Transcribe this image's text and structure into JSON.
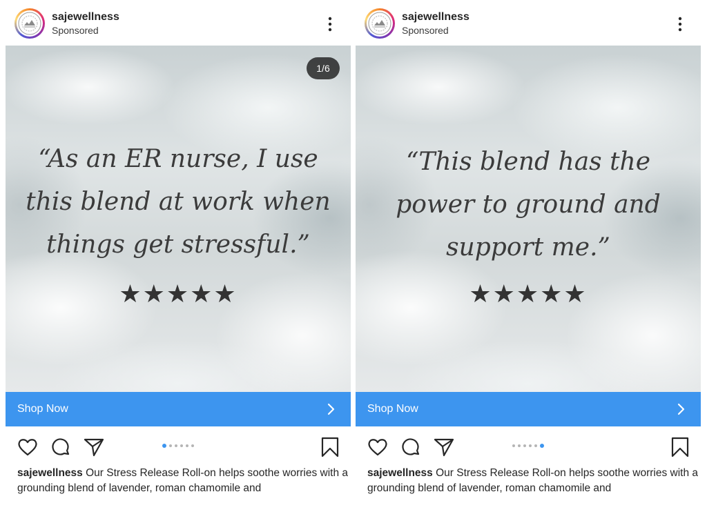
{
  "posts": [
    {
      "username": "sajewellness",
      "sponsored_label": "Sponsored",
      "slide_counter": "1/6",
      "quote": "“As an ER nurse, I use this blend at work when things get stressful.”",
      "rating": {
        "stars": 5,
        "glyphs": "★★★★★"
      },
      "cta_label": "Shop Now",
      "carousel": {
        "total": 6,
        "active": 1
      },
      "caption_user": "sajewellness",
      "caption_text": " Our Stress Release Roll-on helps soothe worries with a grounding blend of lavender, roman chamomile and"
    },
    {
      "username": "sajewellness",
      "sponsored_label": "Sponsored",
      "quote": "“This blend has the power to ground and support me.”",
      "rating": {
        "stars": 5,
        "glyphs": "★★★★★"
      },
      "cta_label": "Shop Now",
      "carousel": {
        "total": 6,
        "active": 6
      },
      "caption_user": "sajewellness",
      "caption_text": " Our Stress Release Roll-on helps soothe worries with a grounding blend of lavender, roman chamomile and"
    }
  ],
  "colors": {
    "cta_blue": "#3d95ef",
    "text": "#262626",
    "dot_active": "#3d95ef",
    "dot_inactive": "#b5b5b5"
  },
  "icons": [
    "more-options-icon",
    "chevron-right-icon",
    "heart-icon",
    "comment-icon",
    "share-icon",
    "bookmark-icon",
    "brand-logo-icon"
  ]
}
